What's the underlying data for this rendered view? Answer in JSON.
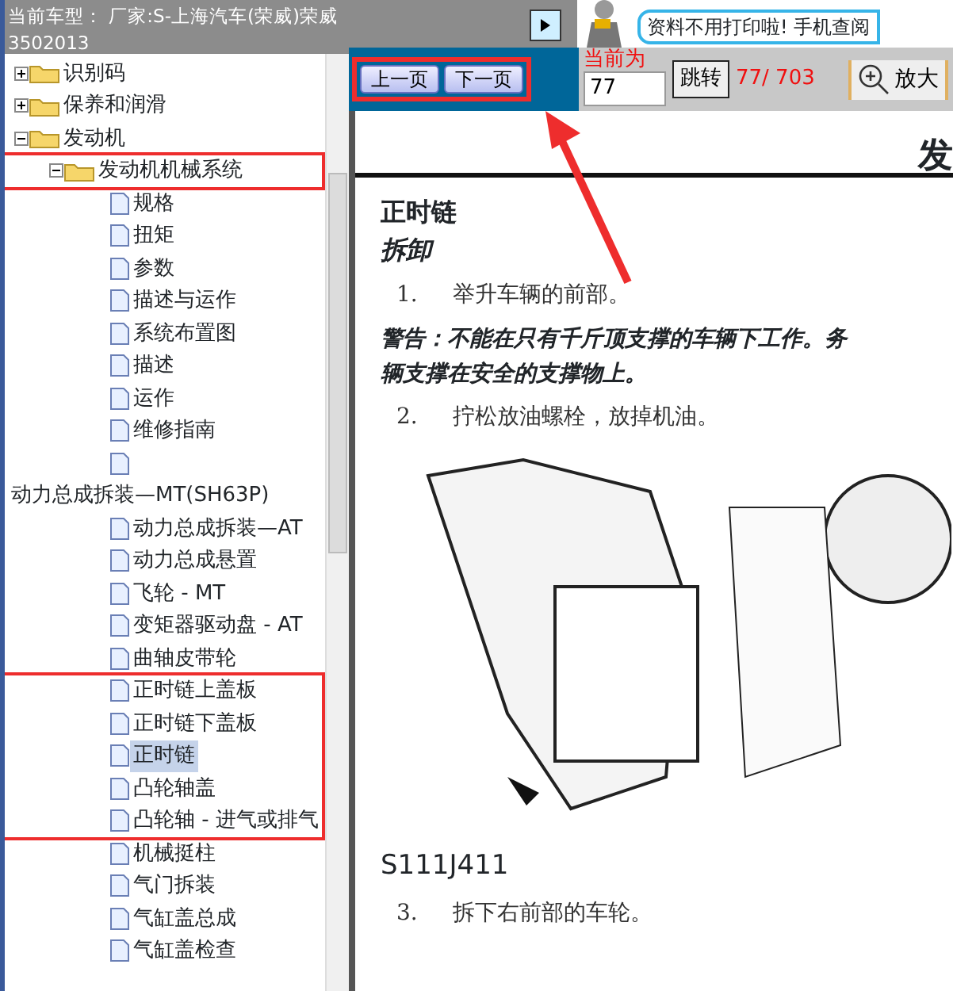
{
  "title_bar": {
    "title": "当前车型： 厂家:S-上海汽车(荣威)荣威",
    "subtitle": "3502013"
  },
  "tree": [
    {
      "label": "识别码",
      "kind": "folder",
      "expanded": false,
      "marked": false
    },
    {
      "label": "保养和润滑",
      "kind": "folder",
      "expanded": false,
      "marked": false
    },
    {
      "label": "发动机",
      "kind": "folder",
      "expanded": true,
      "marked": false,
      "children": [
        {
          "label": "发动机机械系统",
          "kind": "folder",
          "expanded": true,
          "marked": true,
          "children": [
            {
              "label": "规格",
              "kind": "page",
              "selected": false,
              "marked": false
            },
            {
              "label": "扭矩",
              "kind": "page",
              "selected": false,
              "marked": false
            },
            {
              "label": "参数",
              "kind": "page",
              "selected": false,
              "marked": false
            },
            {
              "label": "描述与运作",
              "kind": "page",
              "selected": false,
              "marked": false
            },
            {
              "label": "系统布置图",
              "kind": "page",
              "selected": false,
              "marked": false
            },
            {
              "label": "描述",
              "kind": "page",
              "selected": false,
              "marked": false
            },
            {
              "label": "运作",
              "kind": "page",
              "selected": false,
              "marked": false
            },
            {
              "label": "维修指南",
              "kind": "page",
              "selected": false,
              "marked": false
            },
            {
              "kind": "blank"
            },
            {
              "label": "动力总成拆装—MT(SH63P)",
              "kind": "flush"
            },
            {
              "label": "动力总成拆装—AT",
              "kind": "page",
              "selected": false,
              "marked": false
            },
            {
              "label": "动力总成悬置",
              "kind": "page",
              "selected": false,
              "marked": false
            },
            {
              "label": "飞轮 - MT",
              "kind": "page",
              "selected": false,
              "marked": false
            },
            {
              "label": "变矩器驱动盘 - AT",
              "kind": "page",
              "selected": false,
              "marked": false
            },
            {
              "label": "曲轴皮带轮",
              "kind": "page",
              "selected": false,
              "marked": false
            },
            {
              "label": "正时链上盖板",
              "kind": "page",
              "selected": false,
              "marked": true
            },
            {
              "label": "正时链下盖板",
              "kind": "page",
              "selected": false,
              "marked": true
            },
            {
              "label": "正时链",
              "kind": "page",
              "selected": true,
              "marked": true
            },
            {
              "label": "凸轮轴盖",
              "kind": "page",
              "selected": false,
              "marked": true
            },
            {
              "label": "凸轮轴 - 进气或排气",
              "kind": "page",
              "selected": false,
              "marked": true
            },
            {
              "label": "机械挺柱",
              "kind": "page",
              "selected": false,
              "marked": false
            },
            {
              "label": "气门拆装",
              "kind": "page",
              "selected": false,
              "marked": false
            },
            {
              "label": "气缸盖总成",
              "kind": "page",
              "selected": false,
              "marked": false
            },
            {
              "label": "气缸盖检查",
              "kind": "page",
              "selected": false,
              "marked": false
            }
          ]
        }
      ]
    }
  ],
  "banner": {
    "text": "资料不用打印啦! 手机查阅"
  },
  "toolbar": {
    "prev": "上一页",
    "next": "下一页",
    "nav_marked": true,
    "arrow": true,
    "current_label": "当前为",
    "page_value": "77",
    "jump": "跳转",
    "count": "77/ 703",
    "zoom": "放大"
  },
  "document": {
    "heading": "发",
    "title": "正时链",
    "subtitle": "拆卸",
    "blocks": [
      {
        "kind": "step",
        "number": "1.",
        "text": "举升车辆的前部。"
      },
      {
        "kind": "warning",
        "lines": [
          "警告：不能在只有千斤顶支撑的车辆下工作。务",
          "辆支撑在安全的支撑物上。"
        ]
      },
      {
        "kind": "step",
        "number": "2.",
        "text": "拧松放油螺栓，放掉机油。"
      },
      {
        "kind": "figure",
        "caption": "S111J411"
      },
      {
        "kind": "step",
        "number": "3.",
        "text": "拆下右前部的车轮。"
      }
    ]
  }
}
